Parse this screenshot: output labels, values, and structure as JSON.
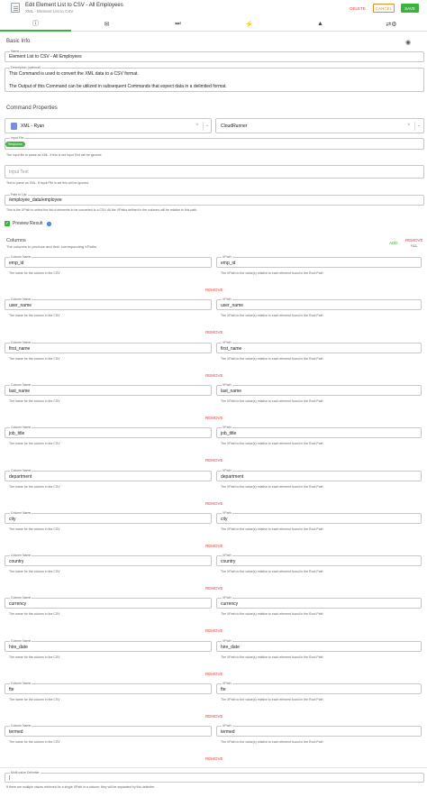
{
  "header": {
    "title": "Edit Element List to CSV - All Employees",
    "subtitle": "XML - Element List to CSV",
    "delete_label": "DELETE",
    "cancel_label": "CANCEL",
    "save_label": "SAVE"
  },
  "tabs": [
    {
      "icon": "info-icon",
      "glyph": "ⓘ"
    },
    {
      "icon": "mail-icon",
      "glyph": "✉"
    },
    {
      "icon": "skip-icon",
      "glyph": "⏭"
    },
    {
      "icon": "lightning-icon",
      "glyph": "⚡"
    },
    {
      "icon": "warning-icon",
      "glyph": "▲"
    },
    {
      "icon": "sync-settings-icon",
      "glyph": "⇄⚙"
    }
  ],
  "basic_info": {
    "title": "Basic Info",
    "name_label": "Name",
    "name_value": "Element List to CSV - All Employees",
    "description_label": "Description (optional)",
    "description_line1": "This Command is used to convert the XML data to a CSV format.",
    "description_line2": "The Output of this Command can be utilized in subsequent Commands that expect data in a delimited format."
  },
  "command_properties": {
    "title": "Command Properties",
    "source_select": "XML - Ryan",
    "runner_select": "CloudRunner",
    "input_file_label": "Input File",
    "input_file_chip": "Response",
    "input_file_helper": "The input file to parse as XML. If this is set Input Text will be ignored.",
    "input_text_placeholder": "Input Text",
    "input_text_helper": "Text to parse as XML. If Input File is set this will be ignored.",
    "path_label": "Path to List",
    "path_value": "/employee_data/employee",
    "path_helper": "This is the XPath to select the list of elements to be converted to a CSV. All the XPaths defined in the columns will be relative to this path.",
    "preview_label": "Preview Result"
  },
  "columns": {
    "title": "Columns",
    "subtitle": "The columns to produce and their corresponding XPaths",
    "add_label": "ADD",
    "remove_all_line1": "REMOVE",
    "remove_all_line2": "ALL",
    "column_name_label": "Column Name",
    "xpath_label": "XPath",
    "column_helper": "The name for the column in the CSV",
    "xpath_helper": "The XPath to the value(s) relative to each element found in the Root Path",
    "remove_label": "REMOVE",
    "rows": [
      {
        "name": "emp_id",
        "xpath": "emp_id"
      },
      {
        "name": "user_name",
        "xpath": "user_name"
      },
      {
        "name": "first_name",
        "xpath": "first_name"
      },
      {
        "name": "last_name",
        "xpath": "last_name"
      },
      {
        "name": "job_title",
        "xpath": "job_title"
      },
      {
        "name": "department",
        "xpath": "department"
      },
      {
        "name": "city",
        "xpath": "city"
      },
      {
        "name": "country",
        "xpath": "country"
      },
      {
        "name": "currency",
        "xpath": "currency"
      },
      {
        "name": "hire_date",
        "xpath": "hire_date"
      },
      {
        "name": "fte",
        "xpath": "fte"
      },
      {
        "name": "termed",
        "xpath": "termed"
      }
    ]
  },
  "multi_value": {
    "label": "Multi-value Delimiter",
    "value": "|",
    "helper": "If there are multiple values retrieved for a single XPath in a column, they will be separated by this delimiter."
  }
}
